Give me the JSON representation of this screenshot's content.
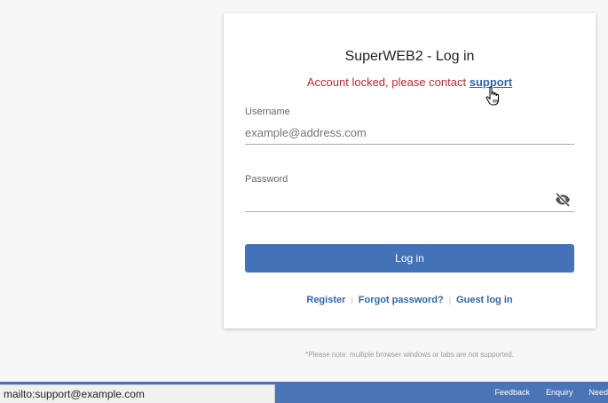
{
  "login": {
    "title": "SuperWEB2 - Log in",
    "error_text": "Account locked, please contact ",
    "error_link": "support",
    "username_label": "Username",
    "username_placeholder": "example@address.com",
    "username_value": "",
    "password_label": "Password",
    "password_value": "",
    "password_toggle_icon": "eye-slash-icon",
    "login_button": "Log in",
    "links": [
      "Register",
      "Forgot password?",
      "Guest log in"
    ]
  },
  "note": "*Please note: multiple browser windows or tabs are not supported.",
  "footer": {
    "links": [
      "Feedback",
      "Enquiry",
      "Need"
    ]
  },
  "status_bar": "mailto:support@example.com",
  "colors": {
    "accent": "#4472b8",
    "error": "#c0282d",
    "link": "#2f66b3"
  }
}
